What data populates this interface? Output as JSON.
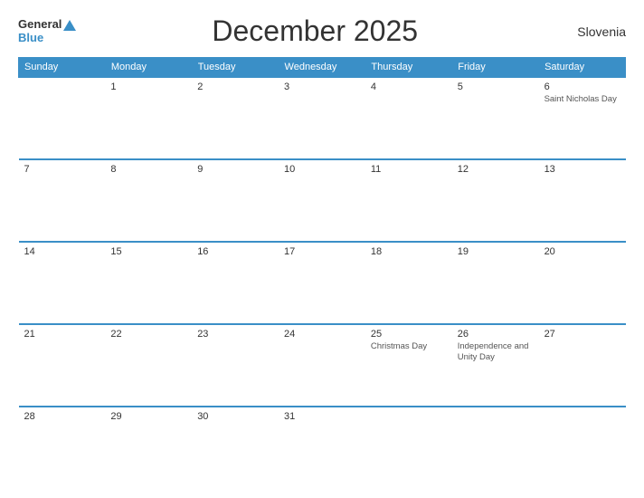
{
  "header": {
    "logo_general": "General",
    "logo_blue": "Blue",
    "title": "December 2025",
    "country": "Slovenia"
  },
  "calendar": {
    "days_of_week": [
      "Sunday",
      "Monday",
      "Tuesday",
      "Wednesday",
      "Thursday",
      "Friday",
      "Saturday"
    ],
    "weeks": [
      [
        {
          "num": "",
          "holiday": ""
        },
        {
          "num": "1",
          "holiday": ""
        },
        {
          "num": "2",
          "holiday": ""
        },
        {
          "num": "3",
          "holiday": ""
        },
        {
          "num": "4",
          "holiday": ""
        },
        {
          "num": "5",
          "holiday": ""
        },
        {
          "num": "6",
          "holiday": "Saint Nicholas Day"
        }
      ],
      [
        {
          "num": "7",
          "holiday": ""
        },
        {
          "num": "8",
          "holiday": ""
        },
        {
          "num": "9",
          "holiday": ""
        },
        {
          "num": "10",
          "holiday": ""
        },
        {
          "num": "11",
          "holiday": ""
        },
        {
          "num": "12",
          "holiday": ""
        },
        {
          "num": "13",
          "holiday": ""
        }
      ],
      [
        {
          "num": "14",
          "holiday": ""
        },
        {
          "num": "15",
          "holiday": ""
        },
        {
          "num": "16",
          "holiday": ""
        },
        {
          "num": "17",
          "holiday": ""
        },
        {
          "num": "18",
          "holiday": ""
        },
        {
          "num": "19",
          "holiday": ""
        },
        {
          "num": "20",
          "holiday": ""
        }
      ],
      [
        {
          "num": "21",
          "holiday": ""
        },
        {
          "num": "22",
          "holiday": ""
        },
        {
          "num": "23",
          "holiday": ""
        },
        {
          "num": "24",
          "holiday": ""
        },
        {
          "num": "25",
          "holiday": "Christmas Day"
        },
        {
          "num": "26",
          "holiday": "Independence and Unity Day"
        },
        {
          "num": "27",
          "holiday": ""
        }
      ],
      [
        {
          "num": "28",
          "holiday": ""
        },
        {
          "num": "29",
          "holiday": ""
        },
        {
          "num": "30",
          "holiday": ""
        },
        {
          "num": "31",
          "holiday": ""
        },
        {
          "num": "",
          "holiday": ""
        },
        {
          "num": "",
          "holiday": ""
        },
        {
          "num": "",
          "holiday": ""
        }
      ]
    ]
  }
}
